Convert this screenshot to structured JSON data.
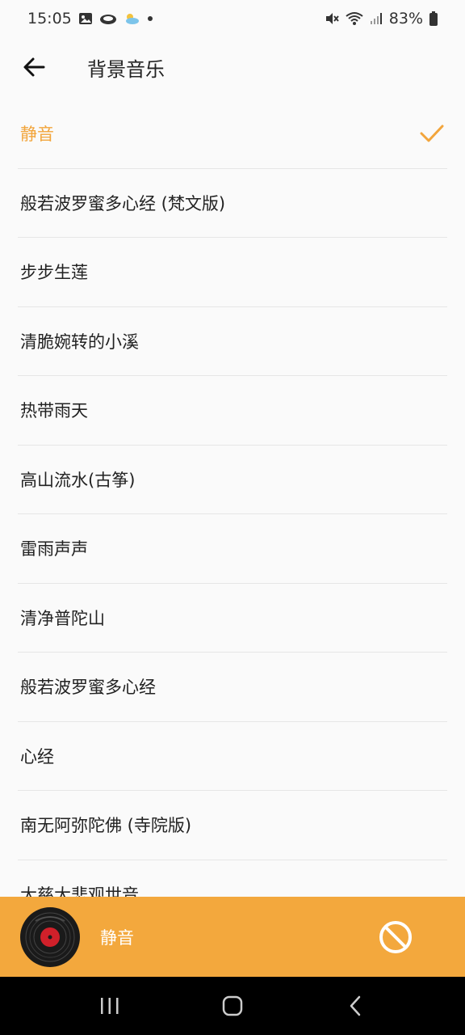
{
  "status_bar": {
    "time": "15:05",
    "battery": "83%"
  },
  "header": {
    "title": "背景音乐"
  },
  "music_list": {
    "items": [
      {
        "label": "静音",
        "selected": true
      },
      {
        "label": "般若波罗蜜多心经 (梵文版)",
        "selected": false
      },
      {
        "label": "步步生莲",
        "selected": false
      },
      {
        "label": "清脆婉转的小溪",
        "selected": false
      },
      {
        "label": "热带雨天",
        "selected": false
      },
      {
        "label": "高山流水(古筝)",
        "selected": false
      },
      {
        "label": "雷雨声声",
        "selected": false
      },
      {
        "label": "清净普陀山",
        "selected": false
      },
      {
        "label": "般若波罗蜜多心经",
        "selected": false
      },
      {
        "label": "心经",
        "selected": false
      },
      {
        "label": "南无阿弥陀佛 (寺院版)",
        "selected": false
      },
      {
        "label": "大慈大悲观世音",
        "selected": false
      }
    ]
  },
  "player": {
    "current": "静音"
  },
  "colors": {
    "accent": "#f3a83d",
    "selected_text": "#f2a53c"
  },
  "icons": {
    "back": "arrow-left-icon",
    "check": "checkmark-icon",
    "disc": "vinyl-record-icon",
    "mute": "prohibited-icon"
  }
}
